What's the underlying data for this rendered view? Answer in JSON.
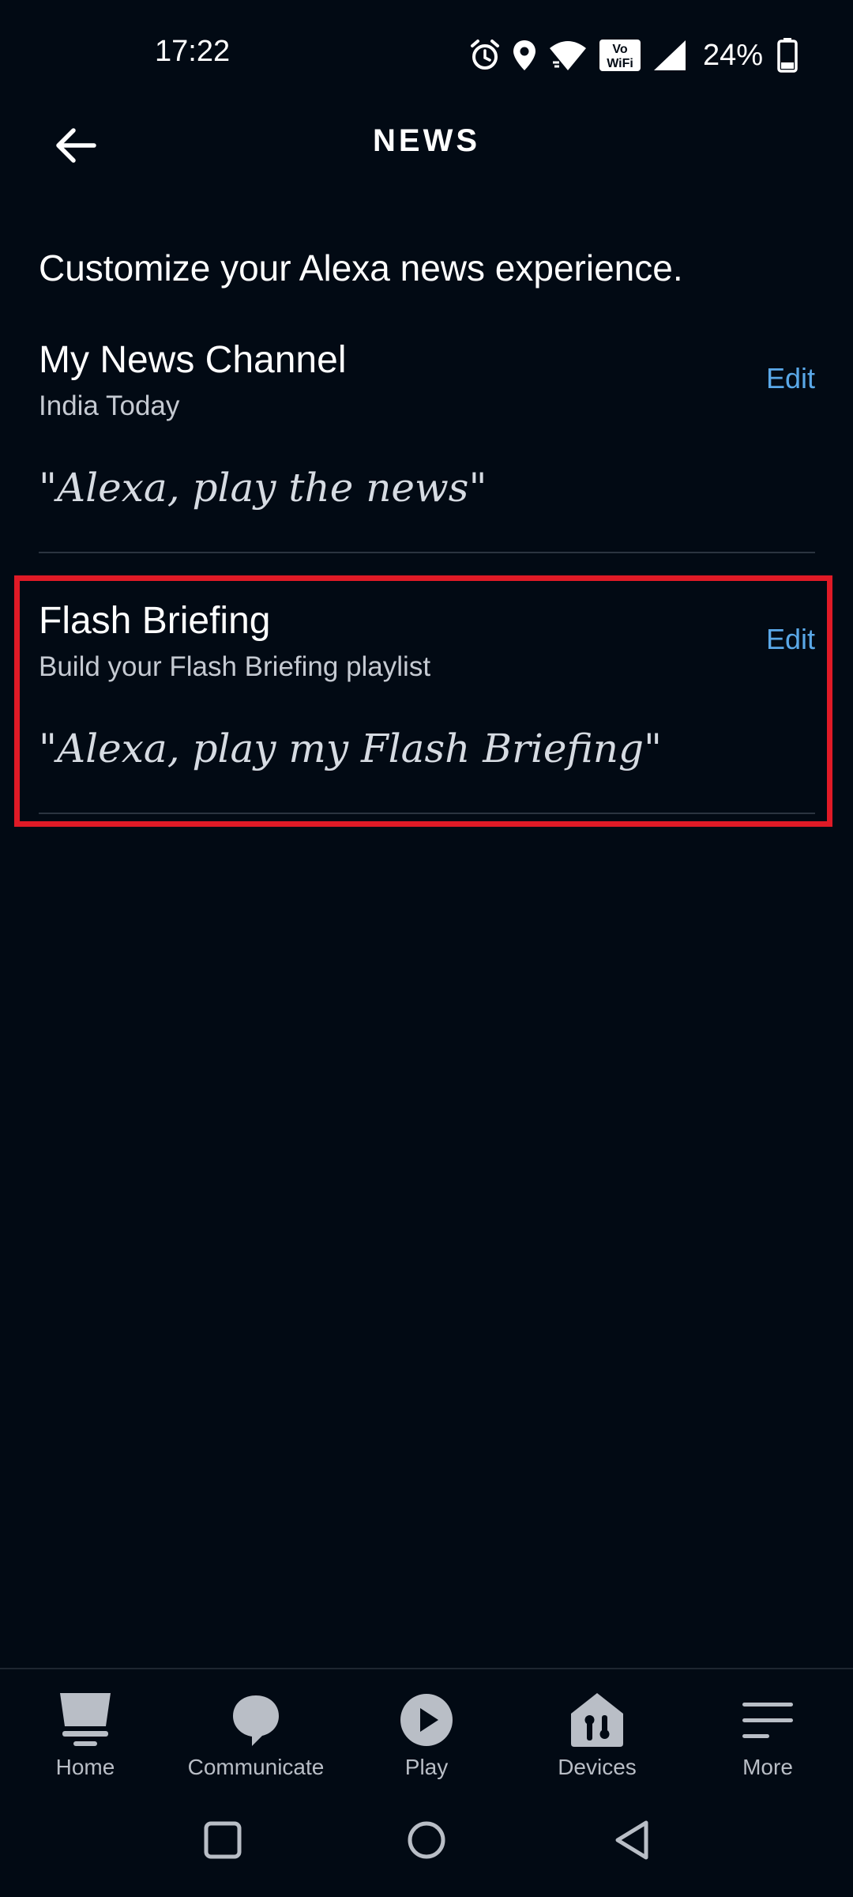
{
  "status_bar": {
    "time": "17:22",
    "battery_percent": "24%",
    "icons": [
      "alarm-icon",
      "location-icon",
      "wifi-icon",
      "vowifi-icon",
      "signal-icon",
      "battery-icon"
    ],
    "vowifi_text_top": "Vo",
    "vowifi_text_bottom": "WiFi"
  },
  "header": {
    "title": "NEWS",
    "back_icon": "back-arrow-icon"
  },
  "intro": "Customize your Alexa news experience.",
  "sections": [
    {
      "title": "My News Channel",
      "subtitle": "India Today",
      "edit_label": "Edit",
      "utterance": "\"Alexa, play the news\""
    },
    {
      "title": "Flash Briefing",
      "subtitle": "Build your Flash Briefing playlist",
      "edit_label": "Edit",
      "utterance": "\"Alexa, play my Flash Briefing\"",
      "highlighted": true
    }
  ],
  "bottom_nav": [
    {
      "label": "Home",
      "icon": "home-icon"
    },
    {
      "label": "Communicate",
      "icon": "chat-bubble-icon"
    },
    {
      "label": "Play",
      "icon": "play-icon"
    },
    {
      "label": "Devices",
      "icon": "devices-icon"
    },
    {
      "label": "More",
      "icon": "menu-icon"
    }
  ],
  "android_nav": [
    "recents-icon",
    "home-circle-icon",
    "back-triangle-icon"
  ],
  "colors": {
    "background": "#020a14",
    "accent_link": "#5aa8e8",
    "highlight_border": "#e01a26",
    "divider": "#2b3440"
  }
}
